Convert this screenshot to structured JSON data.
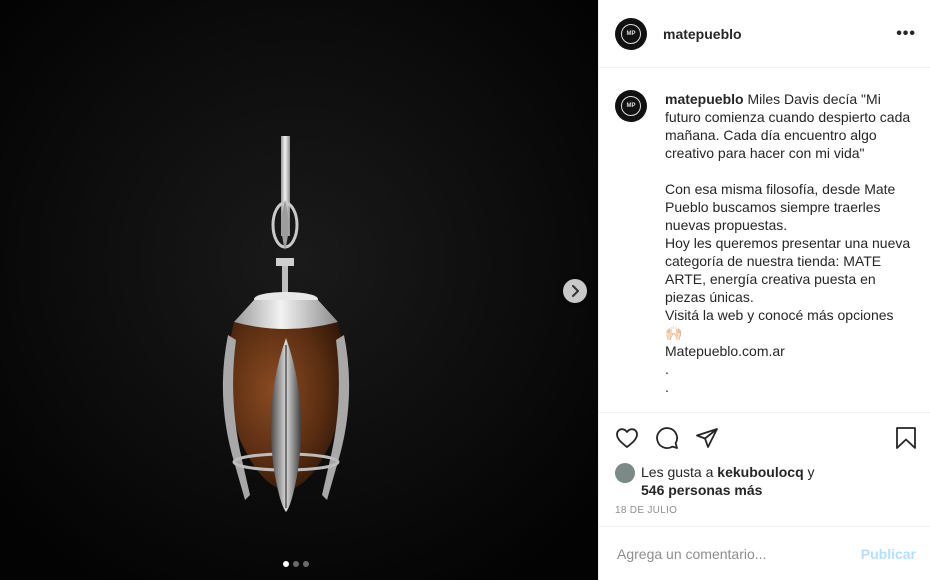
{
  "account": {
    "username": "matepueblo",
    "avatar_initials": "MP"
  },
  "header": {
    "more_label": "•••"
  },
  "caption": {
    "username": "matepueblo",
    "lines_p1": [
      "Miles Davis decía \"Mi futuro comienza cuando despierto cada mañana. Cada día encuentro algo creativo para hacer con mi vida\""
    ],
    "p2": "Con esa misma filosofía, desde Mate Pueblo buscamos siempre traerles nuevas propuestas.",
    "p3": "Hoy les queremos presentar una nueva categoría de nuestra tienda: MATE ARTE, energía creativa puesta en piezas únicas.",
    "p4": "Visitá la web y conocé más opciones",
    "emoji": "🙌🏻",
    "link": "Matepueblo.com.ar",
    "dot1": ".",
    "dot2": "."
  },
  "likes": {
    "prefix": "Les gusta a ",
    "user": "kekuboulocq",
    "joiner": " y",
    "others": "546 personas más"
  },
  "date": "18 DE JULIO",
  "comment": {
    "placeholder": "Agrega un comentario...",
    "publish_label": "Publicar"
  },
  "carousel": {
    "slide_count": 3,
    "active_index": 0
  },
  "icons": [
    "heart-icon",
    "comment-icon",
    "share-icon",
    "bookmark-icon",
    "chevron-right-icon",
    "more-icon"
  ],
  "colors": {
    "publish": "#b2dffc",
    "date": "#8e8e8e",
    "border": "#efefef"
  }
}
